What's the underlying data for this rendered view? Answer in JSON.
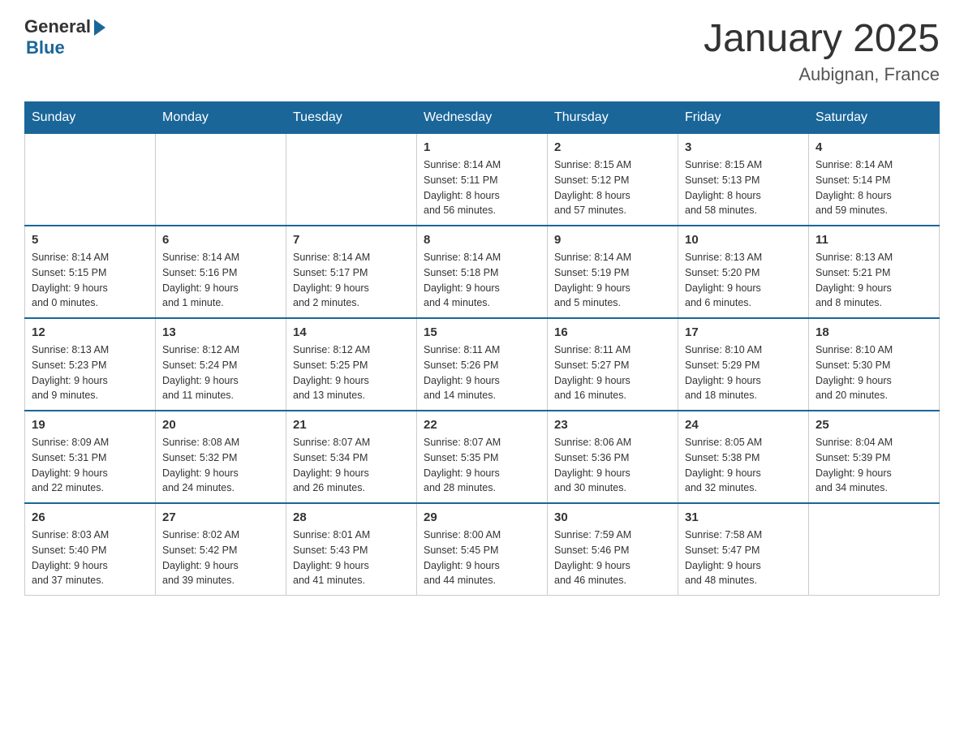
{
  "header": {
    "logo_general": "General",
    "logo_blue": "Blue",
    "title": "January 2025",
    "subtitle": "Aubignan, France"
  },
  "weekdays": [
    "Sunday",
    "Monday",
    "Tuesday",
    "Wednesday",
    "Thursday",
    "Friday",
    "Saturday"
  ],
  "weeks": [
    [
      {
        "day": "",
        "info": ""
      },
      {
        "day": "",
        "info": ""
      },
      {
        "day": "",
        "info": ""
      },
      {
        "day": "1",
        "info": "Sunrise: 8:14 AM\nSunset: 5:11 PM\nDaylight: 8 hours\nand 56 minutes."
      },
      {
        "day": "2",
        "info": "Sunrise: 8:15 AM\nSunset: 5:12 PM\nDaylight: 8 hours\nand 57 minutes."
      },
      {
        "day": "3",
        "info": "Sunrise: 8:15 AM\nSunset: 5:13 PM\nDaylight: 8 hours\nand 58 minutes."
      },
      {
        "day": "4",
        "info": "Sunrise: 8:14 AM\nSunset: 5:14 PM\nDaylight: 8 hours\nand 59 minutes."
      }
    ],
    [
      {
        "day": "5",
        "info": "Sunrise: 8:14 AM\nSunset: 5:15 PM\nDaylight: 9 hours\nand 0 minutes."
      },
      {
        "day": "6",
        "info": "Sunrise: 8:14 AM\nSunset: 5:16 PM\nDaylight: 9 hours\nand 1 minute."
      },
      {
        "day": "7",
        "info": "Sunrise: 8:14 AM\nSunset: 5:17 PM\nDaylight: 9 hours\nand 2 minutes."
      },
      {
        "day": "8",
        "info": "Sunrise: 8:14 AM\nSunset: 5:18 PM\nDaylight: 9 hours\nand 4 minutes."
      },
      {
        "day": "9",
        "info": "Sunrise: 8:14 AM\nSunset: 5:19 PM\nDaylight: 9 hours\nand 5 minutes."
      },
      {
        "day": "10",
        "info": "Sunrise: 8:13 AM\nSunset: 5:20 PM\nDaylight: 9 hours\nand 6 minutes."
      },
      {
        "day": "11",
        "info": "Sunrise: 8:13 AM\nSunset: 5:21 PM\nDaylight: 9 hours\nand 8 minutes."
      }
    ],
    [
      {
        "day": "12",
        "info": "Sunrise: 8:13 AM\nSunset: 5:23 PM\nDaylight: 9 hours\nand 9 minutes."
      },
      {
        "day": "13",
        "info": "Sunrise: 8:12 AM\nSunset: 5:24 PM\nDaylight: 9 hours\nand 11 minutes."
      },
      {
        "day": "14",
        "info": "Sunrise: 8:12 AM\nSunset: 5:25 PM\nDaylight: 9 hours\nand 13 minutes."
      },
      {
        "day": "15",
        "info": "Sunrise: 8:11 AM\nSunset: 5:26 PM\nDaylight: 9 hours\nand 14 minutes."
      },
      {
        "day": "16",
        "info": "Sunrise: 8:11 AM\nSunset: 5:27 PM\nDaylight: 9 hours\nand 16 minutes."
      },
      {
        "day": "17",
        "info": "Sunrise: 8:10 AM\nSunset: 5:29 PM\nDaylight: 9 hours\nand 18 minutes."
      },
      {
        "day": "18",
        "info": "Sunrise: 8:10 AM\nSunset: 5:30 PM\nDaylight: 9 hours\nand 20 minutes."
      }
    ],
    [
      {
        "day": "19",
        "info": "Sunrise: 8:09 AM\nSunset: 5:31 PM\nDaylight: 9 hours\nand 22 minutes."
      },
      {
        "day": "20",
        "info": "Sunrise: 8:08 AM\nSunset: 5:32 PM\nDaylight: 9 hours\nand 24 minutes."
      },
      {
        "day": "21",
        "info": "Sunrise: 8:07 AM\nSunset: 5:34 PM\nDaylight: 9 hours\nand 26 minutes."
      },
      {
        "day": "22",
        "info": "Sunrise: 8:07 AM\nSunset: 5:35 PM\nDaylight: 9 hours\nand 28 minutes."
      },
      {
        "day": "23",
        "info": "Sunrise: 8:06 AM\nSunset: 5:36 PM\nDaylight: 9 hours\nand 30 minutes."
      },
      {
        "day": "24",
        "info": "Sunrise: 8:05 AM\nSunset: 5:38 PM\nDaylight: 9 hours\nand 32 minutes."
      },
      {
        "day": "25",
        "info": "Sunrise: 8:04 AM\nSunset: 5:39 PM\nDaylight: 9 hours\nand 34 minutes."
      }
    ],
    [
      {
        "day": "26",
        "info": "Sunrise: 8:03 AM\nSunset: 5:40 PM\nDaylight: 9 hours\nand 37 minutes."
      },
      {
        "day": "27",
        "info": "Sunrise: 8:02 AM\nSunset: 5:42 PM\nDaylight: 9 hours\nand 39 minutes."
      },
      {
        "day": "28",
        "info": "Sunrise: 8:01 AM\nSunset: 5:43 PM\nDaylight: 9 hours\nand 41 minutes."
      },
      {
        "day": "29",
        "info": "Sunrise: 8:00 AM\nSunset: 5:45 PM\nDaylight: 9 hours\nand 44 minutes."
      },
      {
        "day": "30",
        "info": "Sunrise: 7:59 AM\nSunset: 5:46 PM\nDaylight: 9 hours\nand 46 minutes."
      },
      {
        "day": "31",
        "info": "Sunrise: 7:58 AM\nSunset: 5:47 PM\nDaylight: 9 hours\nand 48 minutes."
      },
      {
        "day": "",
        "info": ""
      }
    ]
  ]
}
